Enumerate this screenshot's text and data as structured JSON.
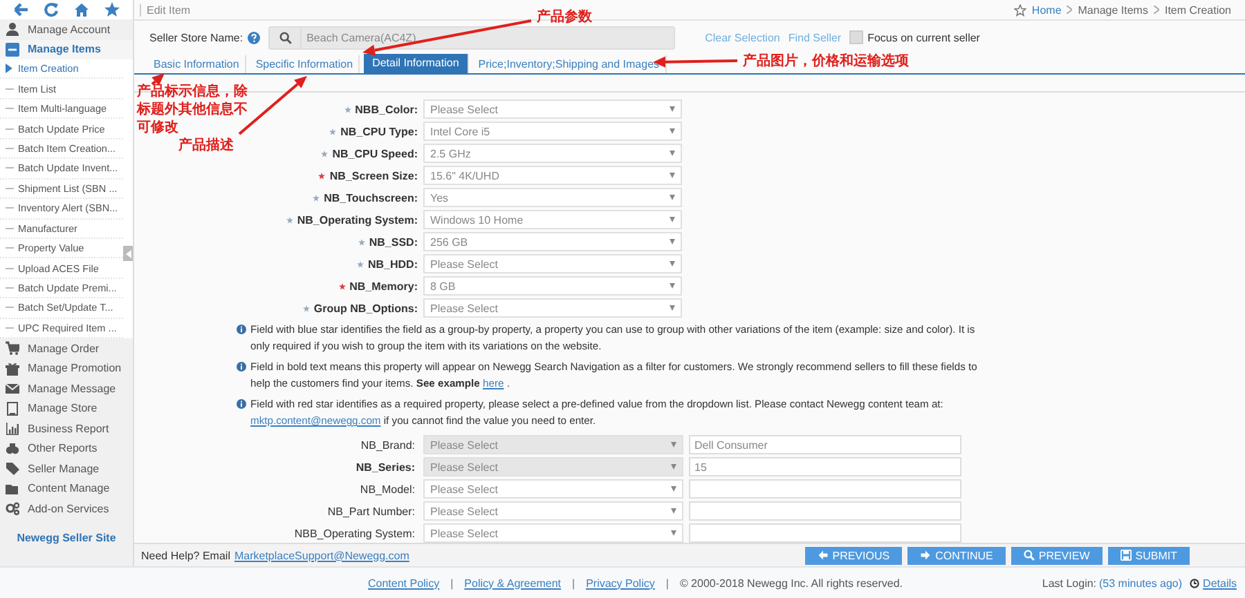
{
  "topbar": {
    "title": "Edit Item",
    "breadcrumb": [
      "Home",
      "Manage Items",
      "Item Creation"
    ]
  },
  "sidebar": {
    "items": [
      {
        "label": "Manage Account",
        "expanded": false
      },
      {
        "label": "Manage Items",
        "expanded": true,
        "children": [
          {
            "label": "Item Creation",
            "selected": true
          },
          {
            "label": "Item List",
            "selected": false
          },
          {
            "label": "Item Multi-language",
            "selected": false
          },
          {
            "label": "Batch Update Price",
            "selected": false
          },
          {
            "label": "Batch Item Creation...",
            "selected": false
          },
          {
            "label": "Batch Update Invent...",
            "selected": false
          },
          {
            "label": "Shipment List (SBN ...",
            "selected": false
          },
          {
            "label": "Inventory Alert (SBN...",
            "selected": false
          },
          {
            "label": "Manufacturer",
            "selected": false
          },
          {
            "label": "Property Value",
            "selected": false
          },
          {
            "label": "Upload ACES File",
            "selected": false
          },
          {
            "label": "Batch Update Premi...",
            "selected": false
          },
          {
            "label": "Batch Set/Update T...",
            "selected": false
          },
          {
            "label": "UPC Required Item ...",
            "selected": false
          }
        ]
      },
      {
        "label": "Manage Order",
        "expanded": false
      },
      {
        "label": "Manage Promotion",
        "expanded": false
      },
      {
        "label": "Manage Message",
        "expanded": false
      },
      {
        "label": "Manage Store",
        "expanded": false
      },
      {
        "label": "Business Report",
        "expanded": false
      },
      {
        "label": "Other Reports",
        "expanded": false
      },
      {
        "label": "Seller Manage",
        "expanded": false
      },
      {
        "label": "Content Manage",
        "expanded": false
      },
      {
        "label": "Add-on Services",
        "expanded": false
      }
    ],
    "footer": "Newegg Seller Site"
  },
  "seller": {
    "label": "Seller Store Name:",
    "value": "Beach Camera(AC4Z)",
    "links": [
      "Clear Selection",
      "Find Seller"
    ],
    "focus": {
      "label": "Focus on current seller",
      "checked": false
    }
  },
  "tabs": [
    {
      "label": "Basic Information",
      "selected": false
    },
    {
      "label": "Specific Information",
      "selected": false
    },
    {
      "label": "Detail Information",
      "selected": true
    },
    {
      "label": "Price;Inventory;Shipping and Images",
      "selected": false
    }
  ],
  "fields": [
    {
      "label": "NBB_Color:",
      "required": false,
      "bold": true,
      "value": "Please Select"
    },
    {
      "label": "NB_CPU Type:",
      "required": false,
      "bold": true,
      "value": "Intel Core i5"
    },
    {
      "label": "NB_CPU Speed:",
      "required": false,
      "bold": true,
      "value": "2.5 GHz"
    },
    {
      "label": "NB_Screen Size:",
      "required": true,
      "bold": true,
      "value": "15.6\" 4K/UHD"
    },
    {
      "label": "NB_Touchscreen:",
      "required": false,
      "bold": true,
      "value": "Yes"
    },
    {
      "label": "NB_Operating System:",
      "required": false,
      "bold": true,
      "value": "Windows 10 Home"
    },
    {
      "label": "NB_SSD:",
      "required": false,
      "bold": true,
      "value": "256 GB"
    },
    {
      "label": "NB_HDD:",
      "required": false,
      "bold": true,
      "value": "Please Select"
    },
    {
      "label": "NB_Memory:",
      "required": true,
      "bold": true,
      "value": "8 GB"
    },
    {
      "label": "Group NB_Options:",
      "required": false,
      "bold": true,
      "value": "Please Select"
    }
  ],
  "notes": [
    {
      "parts": [
        {
          "kind": "text",
          "text": "Field with blue star identifies the field as a group-by property, a property you can use to group with other variations of the item (example: size and color). It is only required if you wish to group the item with its variations on the website."
        }
      ]
    },
    {
      "parts": [
        {
          "kind": "text",
          "text": "Field in bold text means this property will appear on Newegg Search Navigation as a filter for customers. We strongly recommend sellers to fill these fields to help the customers find your items. **See example** "
        },
        {
          "kind": "link",
          "text": "here"
        },
        {
          "kind": "text",
          "text": " ."
        }
      ]
    },
    {
      "parts": [
        {
          "kind": "text",
          "text": "Field with red star identifies as a required property, please select a pre-defined value from the dropdown list. Please contact Newegg content team at: "
        },
        {
          "kind": "link",
          "text": "mktp.content@newegg.com"
        },
        {
          "kind": "text",
          "text": " if you cannot find the value you need to enter."
        }
      ]
    }
  ],
  "properties": [
    {
      "label": "NB_Brand:",
      "bold": false,
      "disabled": true,
      "select": "Please Select",
      "value": "Dell Consumer"
    },
    {
      "label": "NB_Series:",
      "bold": true,
      "disabled": true,
      "select": "Please Select",
      "value": "15"
    },
    {
      "label": "NB_Model:",
      "bold": false,
      "disabled": false,
      "select": "Please Select"
    },
    {
      "label": "NB_Part Number:",
      "bold": false,
      "disabled": false,
      "select": "Please Select"
    },
    {
      "label": "NBB_Operating System:",
      "bold": false,
      "disabled": false,
      "select": "Please Select"
    }
  ],
  "help": {
    "text": "Need Help? Email",
    "link": "MarketplaceSupport@Newegg.com"
  },
  "buttons": [
    "PREVIOUS",
    "CONTINUE",
    "PREVIEW",
    "SUBMIT"
  ],
  "footer": {
    "items": [
      {
        "kind": "link",
        "text": "Content Policy"
      },
      {
        "kind": "sep",
        "text": "|"
      },
      {
        "kind": "link",
        "text": "Policy & Agreement"
      },
      {
        "kind": "sep",
        "text": "|"
      },
      {
        "kind": "link",
        "text": "Privacy Policy"
      },
      {
        "kind": "sep",
        "text": "|"
      },
      {
        "kind": "text",
        "text": "© 2000-2018 Newegg Inc. All rights reserved."
      }
    ],
    "last_login": "Last Login:",
    "last_login_time": "(53 minutes ago)",
    "details": "Details"
  },
  "annotations": [
    {
      "text": "产品参数"
    },
    {
      "text": "产品图片，价格和运输选项"
    },
    {
      "text": "产品标示信息，除标题外其他信息不可修改"
    },
    {
      "text": "产品描述"
    }
  ]
}
